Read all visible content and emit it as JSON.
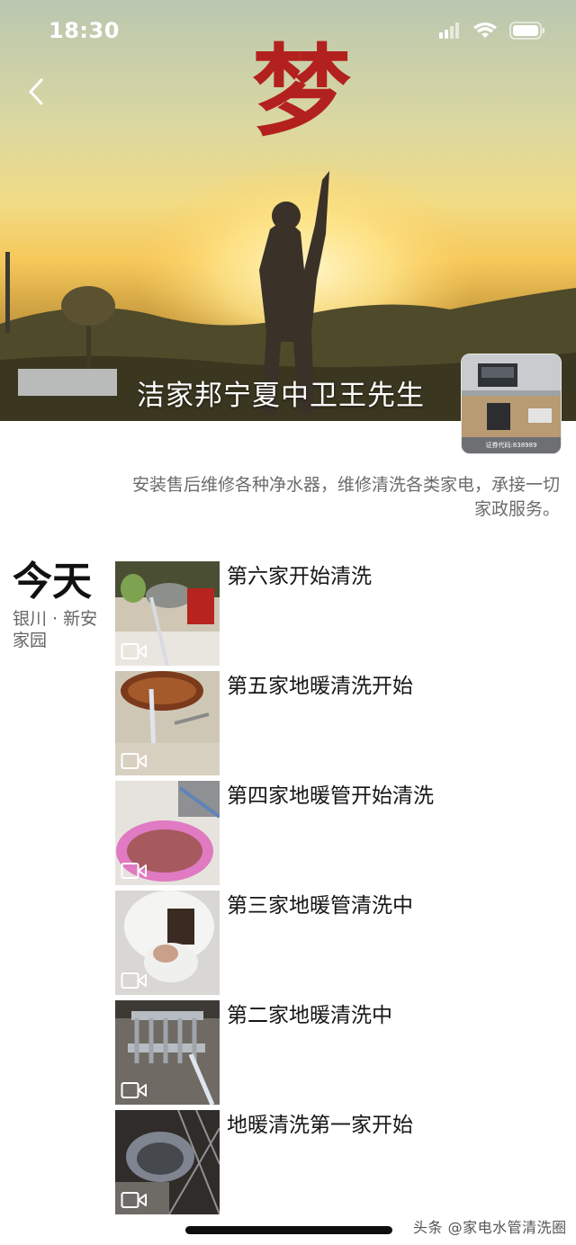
{
  "status_bar": {
    "time": "18:30"
  },
  "cover": {
    "top_banner_text": "梦",
    "caption": "洁家邦宁夏中卫王先生"
  },
  "profile": {
    "signature_line1": "安装售后维修各种净水器，维修清洗各类家电，承接一切",
    "signature_line2": "家政服务。"
  },
  "avatar": {
    "stamp": "证券代码:838989"
  },
  "feed": {
    "date_label": "今天",
    "location": "银川 · 新安家园",
    "posts": [
      {
        "text": "第六家开始清洗",
        "media": "video"
      },
      {
        "text": "第五家地暖清洗开始",
        "media": "video"
      },
      {
        "text": "第四家地暖管开始清洗",
        "media": "video"
      },
      {
        "text": "第三家地暖管清洗中",
        "media": "video"
      },
      {
        "text": "第二家地暖清洗中",
        "media": "video"
      },
      {
        "text": "地暖清洗第一家开始",
        "media": "video"
      }
    ]
  },
  "watermark": "头条 @家电水管清洗圈",
  "icons": [
    "back-arrow-icon",
    "signal-icon",
    "wifi-icon",
    "battery-icon",
    "video-icon"
  ],
  "colors": {
    "text_primary": "#161616",
    "text_secondary": "#6b6b6b",
    "background": "#ffffff"
  }
}
